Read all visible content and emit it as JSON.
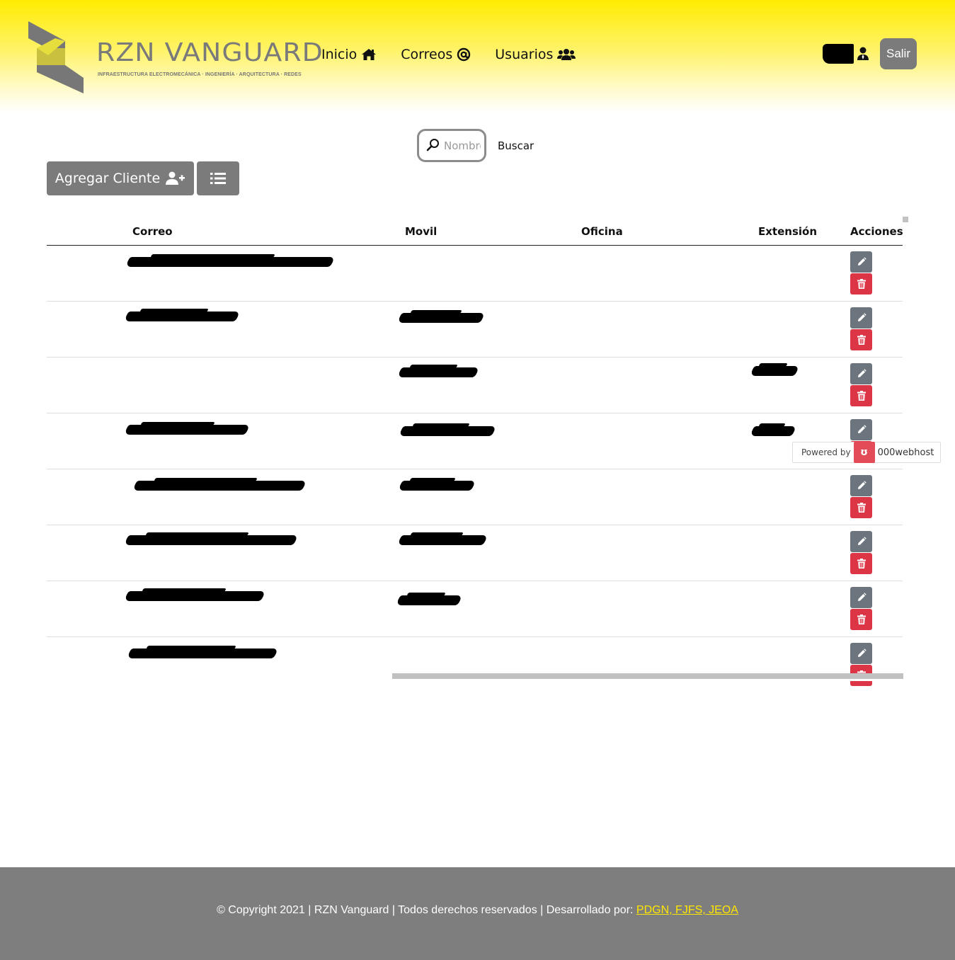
{
  "brand": {
    "title": "RZN VANGUARD",
    "subtitle": "INFRAESTRUCTURA ELECTROMECÁNICA · INGENIERÍA · ARQUITECTURA · REDES",
    "colors": {
      "header_yellow": "#ffec00",
      "gray": "#7b7b7b",
      "danger": "#dc3545",
      "link_yellow": "#ffe600"
    }
  },
  "nav": [
    {
      "label": "Inicio",
      "icon": "home-icon"
    },
    {
      "label": "Correos",
      "icon": "at-icon"
    },
    {
      "label": "Usuarios",
      "icon": "users-icon"
    }
  ],
  "user": {
    "name": "-",
    "icon": "user-tie-icon"
  },
  "logout_label": "Salir",
  "search": {
    "placeholder": "Nombre",
    "button_label": "Buscar",
    "icon": "search-icon"
  },
  "toolbar": {
    "add_client_label": "Agregar Cliente",
    "add_icon": "user-plus-icon",
    "list_icon": "list-icon"
  },
  "table": {
    "columns": [
      "Correo",
      "Movil",
      "Oficina",
      "Extensión",
      "Acciones"
    ],
    "row_count": 8,
    "note_redacted": true
  },
  "row_actions": {
    "edit_icon": "pencil-icon",
    "delete_icon": "trash-icon"
  },
  "powered": {
    "prefix": "Powered by",
    "host": "000webhost"
  },
  "footer": {
    "text": "© Copyright 2021 | RZN Vanguard | Todos derechos reservados | Desarrollado por: ",
    "link_label": "PDGN, FJFS, JEOA"
  }
}
